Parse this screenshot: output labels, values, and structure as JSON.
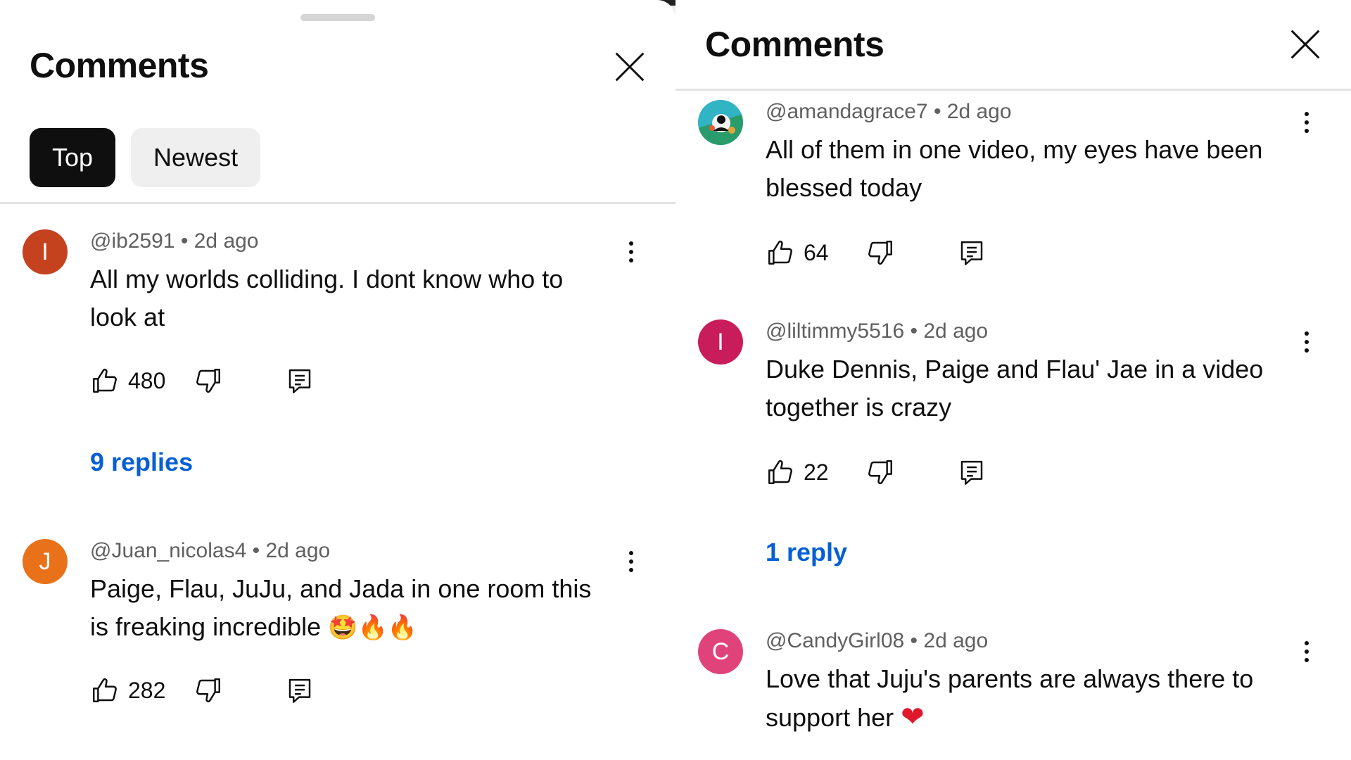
{
  "left_panel": {
    "title": "Comments",
    "filters": [
      {
        "label": "Top",
        "active": true
      },
      {
        "label": "Newest",
        "active": false
      }
    ],
    "comments": [
      {
        "avatar_letter": "I",
        "avatar_color": "#c4421e",
        "handle": "@ib2591",
        "age": "2d ago",
        "text": "All my worlds colliding. I dont know who to look at",
        "likes": "480",
        "replies": "9 replies"
      },
      {
        "avatar_letter": "J",
        "avatar_color": "#e8711a",
        "handle": "@Juan_nicolas4",
        "age": "2d ago",
        "text": "Paige, Flau, JuJu, and Jada in one room this is freaking incredible",
        "emoji": "🤩🔥🔥",
        "likes": "282"
      }
    ]
  },
  "right_panel": {
    "title": "Comments",
    "comments": [
      {
        "avatar_icon": "profile-photo-icon",
        "handle": "@amandagrace7",
        "age": "2d ago",
        "text": "All of them in one video, my eyes have been blessed today",
        "likes": "64"
      },
      {
        "avatar_letter": "I",
        "avatar_color": "#c81d5a",
        "handle": "@liltimmy5516",
        "age": "2d ago",
        "text": "Duke Dennis, Paige and Flau' Jae in a video together is crazy",
        "likes": "22",
        "replies": "1 reply"
      },
      {
        "avatar_letter": "C",
        "avatar_color": "#e0437a",
        "handle": "@CandyGirl08",
        "age": "2d ago",
        "text": "Love that Juju's parents are always there to support her",
        "emoji": "❤"
      }
    ]
  },
  "separator": " • ",
  "colors": {
    "link_blue": "#065fd4",
    "meta_gray": "#606060",
    "chip_bg": "#efefef"
  }
}
